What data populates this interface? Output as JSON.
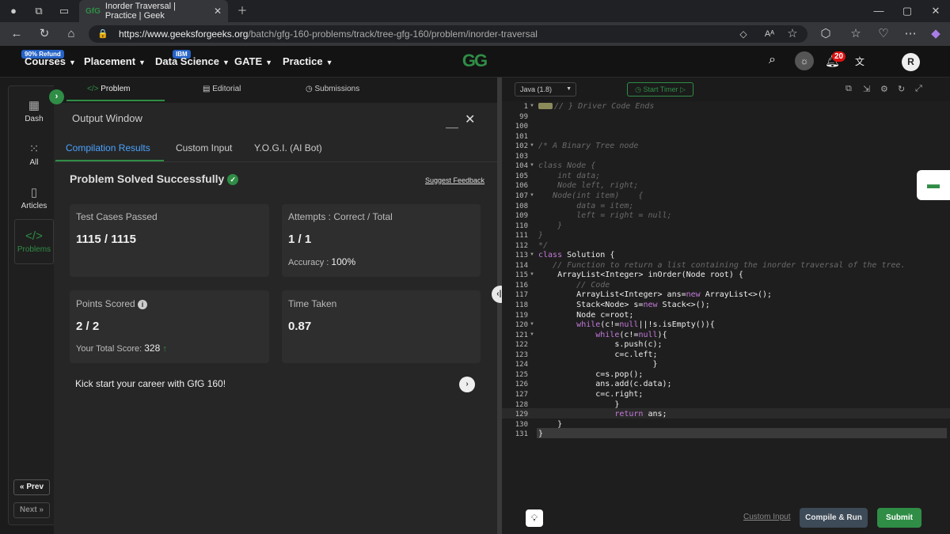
{
  "browser": {
    "tab_title": "Inorder Traversal | Practice | Geek",
    "tab_favicon": "GfG",
    "url_host": "https://www.geeksforgeeks.org",
    "url_path": "/batch/gfg-160-problems/track/tree-gfg-160/problem/inorder-traversal",
    "text_size_icon": "Aᴬ"
  },
  "header": {
    "nav": [
      {
        "label": "Courses",
        "badge": "90% Refund"
      },
      {
        "label": "Placement"
      },
      {
        "label": "Data Science",
        "badge": "IBM"
      },
      {
        "label": "GATE"
      },
      {
        "label": "Practice"
      }
    ],
    "logo": "GG",
    "notification_count": "20",
    "avatar_initial": "R"
  },
  "sidebar": {
    "items": [
      {
        "label": "Dash",
        "icon": "dashboard-icon"
      },
      {
        "label": "All",
        "icon": "grid-icon"
      },
      {
        "label": "Articles",
        "icon": "book-icon"
      },
      {
        "label": "Problems",
        "icon": "code-icon"
      }
    ],
    "prev_label": "« Prev",
    "next_label": "Next »"
  },
  "problem_tabs": {
    "problem": "Problem",
    "editorial": "Editorial",
    "submissions": "Submissions"
  },
  "output": {
    "title": "Output Window",
    "tabs": [
      "Compilation Results",
      "Custom Input",
      "Y.O.G.I. (AI Bot)"
    ],
    "status": "Problem Solved Successfully",
    "suggest_feedback": "Suggest Feedback",
    "cards": {
      "test_cases_label": "Test Cases Passed",
      "test_cases_value": "1115 / 1115",
      "attempts_label": "Attempts : Correct / Total",
      "attempts_value": "1 / 1",
      "accuracy_label": "Accuracy :",
      "accuracy_value": "100%",
      "points_label": "Points Scored",
      "points_value": "2 / 2",
      "total_score_label": "Your Total Score:",
      "total_score_value": "328",
      "time_label": "Time Taken",
      "time_value": "0.87"
    },
    "kick_start": "Kick start your career with GfG 160!"
  },
  "editor": {
    "language": "Java (1.8)",
    "start_timer": "Start Timer",
    "lines": [
      {
        "n": "1",
        "fold": true,
        "code": "// } Driver Code Ends",
        "cls": "cm"
      },
      {
        "n": "99",
        "code": ""
      },
      {
        "n": "100",
        "code": ""
      },
      {
        "n": "101",
        "code": ""
      },
      {
        "n": "102",
        "fold": true,
        "code": "/* A Binary Tree node",
        "cls": "cm"
      },
      {
        "n": "103",
        "code": ""
      },
      {
        "n": "104",
        "fold": true,
        "code": "class Node {",
        "cls": "cm"
      },
      {
        "n": "105",
        "code": "    int data;",
        "cls": "cm"
      },
      {
        "n": "106",
        "code": "    Node left, right;",
        "cls": "cm"
      },
      {
        "n": "107",
        "fold": true,
        "code": "   Node(int item)    {",
        "cls": "cm"
      },
      {
        "n": "108",
        "code": "        data = item;",
        "cls": "cm"
      },
      {
        "n": "109",
        "code": "        left = right = null;",
        "cls": "cm"
      },
      {
        "n": "110",
        "code": "    }",
        "cls": "cm"
      },
      {
        "n": "111",
        "code": "}",
        "cls": "cm"
      },
      {
        "n": "112",
        "code": "*/",
        "cls": "cm"
      },
      {
        "n": "113",
        "fold": true,
        "code": "class Solution {",
        "cls": "ty"
      },
      {
        "n": "114",
        "code": "   // Function to return a list containing the inorder traversal of the tree.",
        "cls": "cm"
      },
      {
        "n": "115",
        "fold": true,
        "code": "    ArrayList<Integer> inOrder(Node root) {",
        "cls": "ty"
      },
      {
        "n": "116",
        "code": "        // Code",
        "cls": "cm"
      },
      {
        "n": "117",
        "code": "        ArrayList<Integer> ans=new ArrayList<>();",
        "cls": "ty"
      },
      {
        "n": "118",
        "code": "        Stack<Node> s=new Stack<>();",
        "cls": "ty"
      },
      {
        "n": "119",
        "code": "        Node c=root;",
        "cls": "ty"
      },
      {
        "n": "120",
        "fold": true,
        "code": "        while(c!=null||!s.isEmpty()){",
        "cls": "ty"
      },
      {
        "n": "121",
        "fold": true,
        "code": "            while(c!=null){",
        "cls": "ty"
      },
      {
        "n": "122",
        "code": "                s.push(c);",
        "cls": "ty"
      },
      {
        "n": "123",
        "code": "                c=c.left;",
        "cls": "ty"
      },
      {
        "n": "124",
        "code": "                        }",
        "cls": "ty"
      },
      {
        "n": "125",
        "code": "            c=s.pop();",
        "cls": "ty"
      },
      {
        "n": "126",
        "code": "            ans.add(c.data);",
        "cls": "ty"
      },
      {
        "n": "127",
        "code": "            c=c.right;",
        "cls": "ty"
      },
      {
        "n": "128",
        "code": "                }",
        "cls": "ty"
      },
      {
        "n": "129",
        "code": "                return ans;",
        "cls": "ty"
      },
      {
        "n": "130",
        "code": "    }",
        "cls": "ty"
      },
      {
        "n": "131",
        "code": "}",
        "cls": "ty"
      }
    ],
    "custom_input": "Custom Input",
    "compile_run": "Compile & Run",
    "submit": "Submit"
  },
  "colors": {
    "accent": "#2f8d46",
    "background": "#1b1b1b",
    "card": "#2e2e2e"
  }
}
